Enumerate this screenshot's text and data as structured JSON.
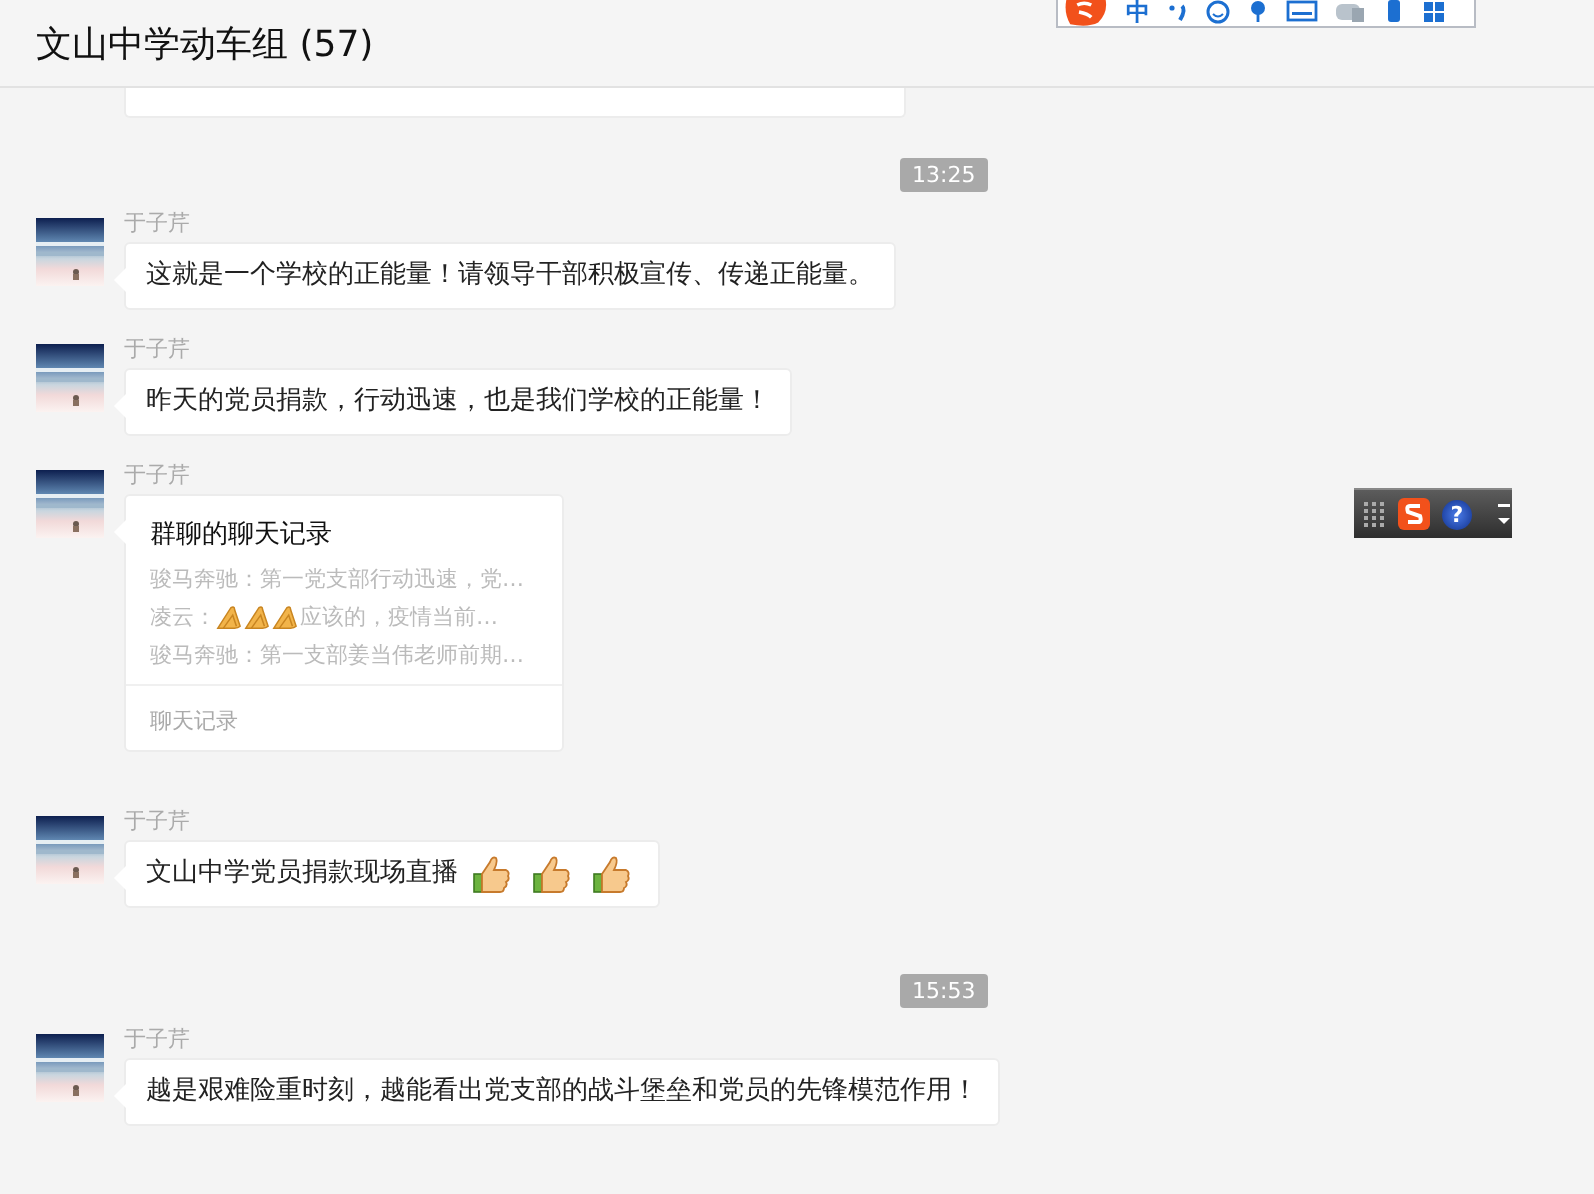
{
  "header": {
    "title": "文山中学动车组 (57)"
  },
  "ime_toolbar": {
    "mode": "中"
  },
  "floating_toolbar": {
    "help": "?"
  },
  "messages": [
    {
      "kind": "time",
      "text": "13:25"
    },
    {
      "kind": "text",
      "sender": "于子芹",
      "text": "这就是一个学校的正能量！请领导干部积极宣传、传递正能量。"
    },
    {
      "kind": "text",
      "sender": "于子芹",
      "text": "昨天的党员捐款，行动迅速，也是我们学校的正能量！"
    },
    {
      "kind": "record",
      "sender": "于子芹",
      "title": "群聊的聊天记录",
      "footer": "聊天记录",
      "lines": [
        {
          "segments": [
            {
              "kind": "text",
              "text": "骏马奔驰：第一党支部行动迅速，党…"
            }
          ]
        },
        {
          "segments": [
            {
              "kind": "text",
              "text": "凌云："
            },
            {
              "kind": "clap"
            },
            {
              "kind": "clap"
            },
            {
              "kind": "clap"
            },
            {
              "kind": "text",
              "text": "应该的，疫情当前…"
            }
          ]
        },
        {
          "segments": [
            {
              "kind": "text",
              "text": "骏马奔驰：第一支部姜当伟老师前期…"
            }
          ]
        }
      ]
    },
    {
      "kind": "text",
      "sender": "于子芹",
      "text": "文山中学党员捐款现场直播",
      "emojis": [
        {
          "kind": "thumbs-up"
        },
        {
          "kind": "thumbs-up"
        },
        {
          "kind": "thumbs-up"
        }
      ]
    },
    {
      "kind": "time",
      "text": "15:53"
    },
    {
      "kind": "text",
      "sender": "于子芹",
      "text": "越是艰难险重时刻，越能看出党支部的战斗堡垒和党员的先锋模范作用！"
    }
  ]
}
